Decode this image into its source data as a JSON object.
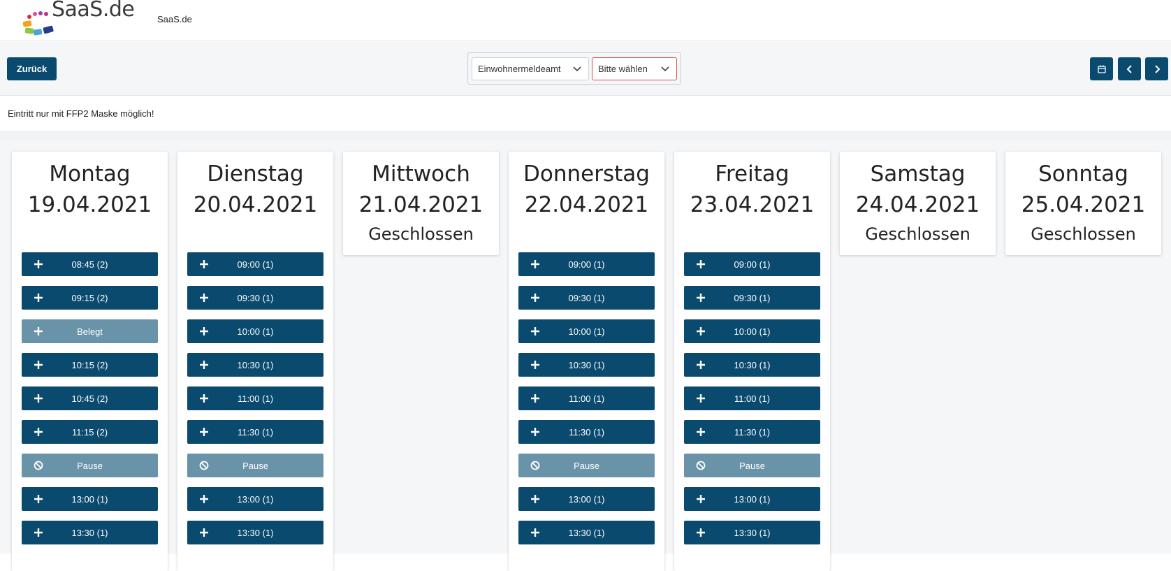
{
  "header": {
    "brand": "SaaS.de",
    "logo_text": "SaaS.de"
  },
  "toolbar": {
    "back_label": "Zurück",
    "office_select": "Einwohnermeldeamt",
    "service_select": "Bitte wählen"
  },
  "notice": "Eintritt nur mit FFP2 Maske möglich!",
  "colors": {
    "primary": "#0a4a6e",
    "muted": "#6893a9",
    "error": "#d9534f"
  },
  "days": [
    {
      "name": "Montag",
      "date": "19.04.2021",
      "closed": false,
      "slots": [
        {
          "label": "08:45 (2)",
          "kind": "free"
        },
        {
          "label": "09:15 (2)",
          "kind": "free"
        },
        {
          "label": "Belegt",
          "kind": "taken"
        },
        {
          "label": "10:15 (2)",
          "kind": "free"
        },
        {
          "label": "10:45 (2)",
          "kind": "free"
        },
        {
          "label": "11:15 (2)",
          "kind": "free"
        },
        {
          "label": "Pause",
          "kind": "pause"
        },
        {
          "label": "13:00 (1)",
          "kind": "free"
        },
        {
          "label": "13:30 (1)",
          "kind": "free"
        }
      ]
    },
    {
      "name": "Dienstag",
      "date": "20.04.2021",
      "closed": false,
      "slots": [
        {
          "label": "09:00 (1)",
          "kind": "free"
        },
        {
          "label": "09:30 (1)",
          "kind": "free"
        },
        {
          "label": "10:00 (1)",
          "kind": "free"
        },
        {
          "label": "10:30 (1)",
          "kind": "free"
        },
        {
          "label": "11:00 (1)",
          "kind": "free"
        },
        {
          "label": "11:30 (1)",
          "kind": "free"
        },
        {
          "label": "Pause",
          "kind": "pause"
        },
        {
          "label": "13:00 (1)",
          "kind": "free"
        },
        {
          "label": "13:30 (1)",
          "kind": "free"
        }
      ]
    },
    {
      "name": "Mittwoch",
      "date": "21.04.2021",
      "closed": true,
      "closed_label": "Geschlossen",
      "slots": []
    },
    {
      "name": "Donnerstag",
      "date": "22.04.2021",
      "closed": false,
      "slots": [
        {
          "label": "09:00 (1)",
          "kind": "free"
        },
        {
          "label": "09:30 (1)",
          "kind": "free"
        },
        {
          "label": "10:00 (1)",
          "kind": "free"
        },
        {
          "label": "10:30 (1)",
          "kind": "free"
        },
        {
          "label": "11:00 (1)",
          "kind": "free"
        },
        {
          "label": "11:30 (1)",
          "kind": "free"
        },
        {
          "label": "Pause",
          "kind": "pause"
        },
        {
          "label": "13:00 (1)",
          "kind": "free"
        },
        {
          "label": "13:30 (1)",
          "kind": "free"
        }
      ]
    },
    {
      "name": "Freitag",
      "date": "23.04.2021",
      "closed": false,
      "slots": [
        {
          "label": "09:00 (1)",
          "kind": "free"
        },
        {
          "label": "09:30 (1)",
          "kind": "free"
        },
        {
          "label": "10:00 (1)",
          "kind": "free"
        },
        {
          "label": "10:30 (1)",
          "kind": "free"
        },
        {
          "label": "11:00 (1)",
          "kind": "free"
        },
        {
          "label": "11:30 (1)",
          "kind": "free"
        },
        {
          "label": "Pause",
          "kind": "pause"
        },
        {
          "label": "13:00 (1)",
          "kind": "free"
        },
        {
          "label": "13:30 (1)",
          "kind": "free"
        }
      ]
    },
    {
      "name": "Samstag",
      "date": "24.04.2021",
      "closed": true,
      "closed_label": "Geschlossen",
      "slots": []
    },
    {
      "name": "Sonntag",
      "date": "25.04.2021",
      "closed": true,
      "closed_label": "Geschlossen",
      "slots": []
    }
  ]
}
